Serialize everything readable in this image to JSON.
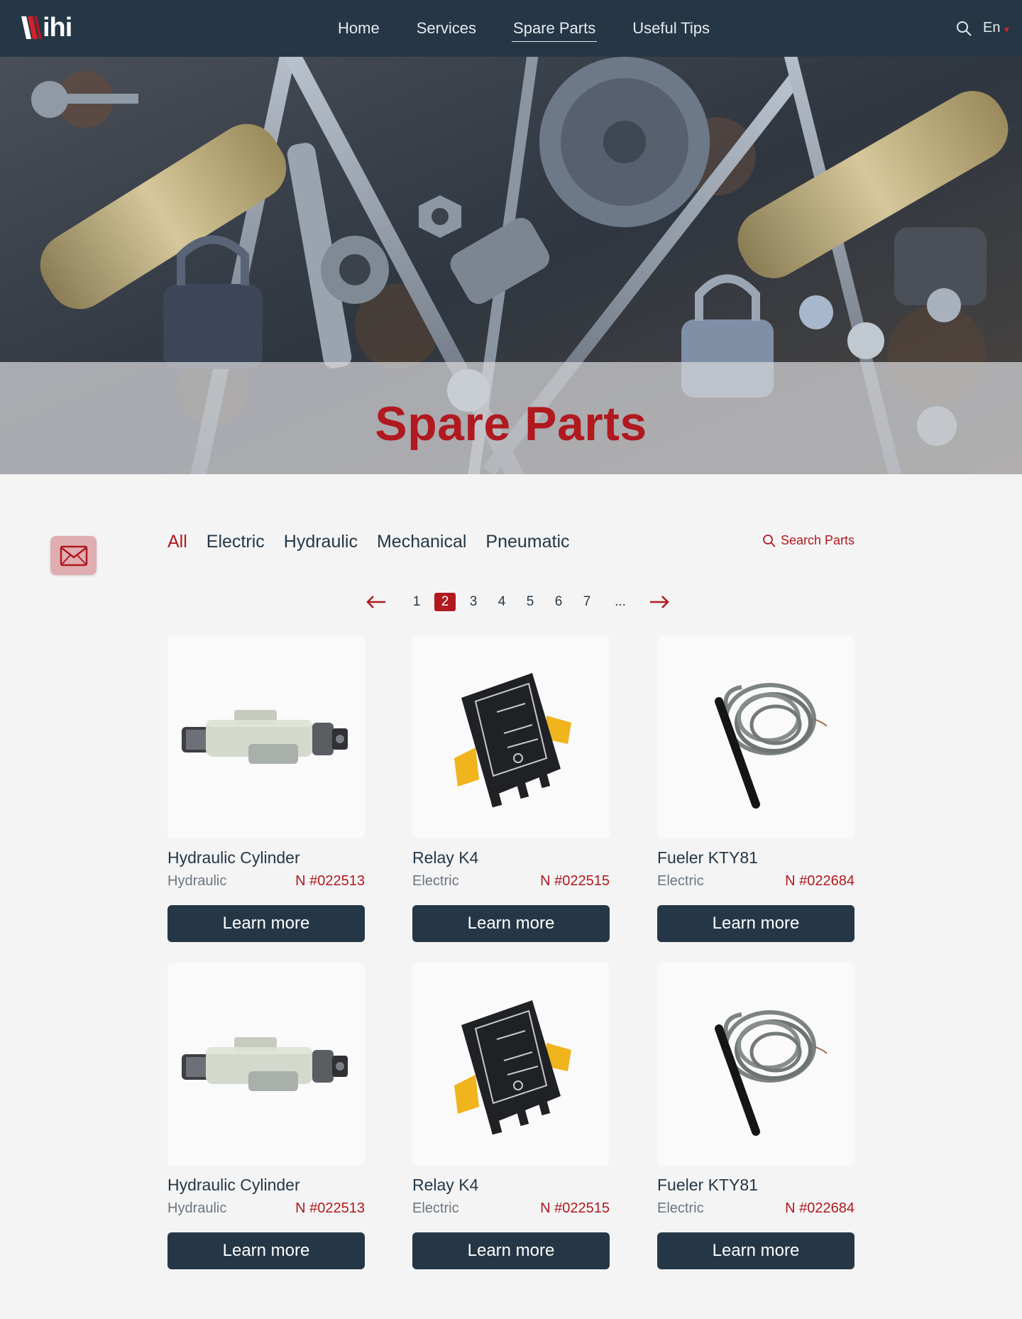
{
  "header": {
    "logo_text": "ihi",
    "nav": [
      "Home",
      "Services",
      "Spare Parts",
      "Useful Tips"
    ],
    "active_nav": "Spare Parts",
    "language": "En",
    "search_icon": "search-icon"
  },
  "hero": {
    "title": "Spare Parts"
  },
  "filters": {
    "items": [
      "All",
      "Electric",
      "Hydraulic",
      "Mechanical",
      "Pneumatic"
    ],
    "active": "All",
    "search_label": "Search Parts"
  },
  "pagination": {
    "pages": [
      "1",
      "2",
      "3",
      "4",
      "5",
      "6",
      "7",
      "..."
    ],
    "current": "2",
    "prev_icon": "arrow-left-icon",
    "next_icon": "arrow-right-icon"
  },
  "products": [
    {
      "name": "Hydraulic Cylinder",
      "category": "Hydraulic",
      "number": "N #022513",
      "button": "Learn more",
      "image": "hydraulic-cylinder"
    },
    {
      "name": "Relay K4",
      "category": "Electric",
      "number": "N #022515",
      "button": "Learn more",
      "image": "relay"
    },
    {
      "name": "Fueler KTY81",
      "category": "Electric",
      "number": "N #022684",
      "button": "Learn more",
      "image": "sensor-cable"
    },
    {
      "name": "Hydraulic Cylinder",
      "category": "Hydraulic",
      "number": "N #022513",
      "button": "Learn more",
      "image": "hydraulic-cylinder"
    },
    {
      "name": "Relay K4",
      "category": "Electric",
      "number": "N #022515",
      "button": "Learn more",
      "image": "relay"
    },
    {
      "name": "Fueler KTY81",
      "category": "Electric",
      "number": "N #022684",
      "button": "Learn more",
      "image": "sensor-cable"
    }
  ],
  "colors": {
    "navy": "#253746",
    "accent_red": "#b0191f",
    "background": "#f4f4f4",
    "mail_button": "#e0aeb2"
  },
  "contact": {
    "icon": "envelope-icon"
  }
}
